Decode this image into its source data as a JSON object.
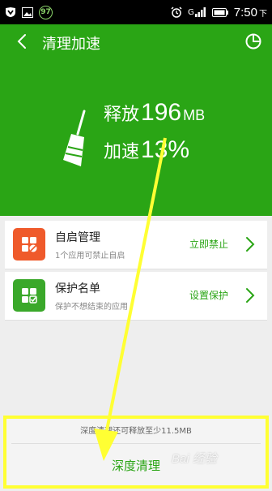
{
  "status_bar": {
    "badge": "97",
    "network": "G",
    "time": "7:50",
    "time_suffix": "下"
  },
  "header": {
    "title": "清理加速",
    "release_label": "释放",
    "release_value": "196",
    "release_unit": "MB",
    "speed_label": "加速",
    "speed_value": "13%"
  },
  "cards": [
    {
      "title": "自启管理",
      "subtitle": "1个应用可禁止自启",
      "action": "立即禁止",
      "icon": "autostart-icon",
      "color": "#ef5a2b"
    },
    {
      "title": "保护名单",
      "subtitle": "保护不想结束的应用",
      "action": "设置保护",
      "icon": "protect-list-icon",
      "color": "#3aa82a"
    }
  ],
  "bottom": {
    "hint": "深度清理还可释放至少11.5MB",
    "button": "深度清理"
  },
  "watermark": "Bai 经验",
  "colors": {
    "primary_green": "#2aa515",
    "annotation_yellow": "#ffff33"
  }
}
